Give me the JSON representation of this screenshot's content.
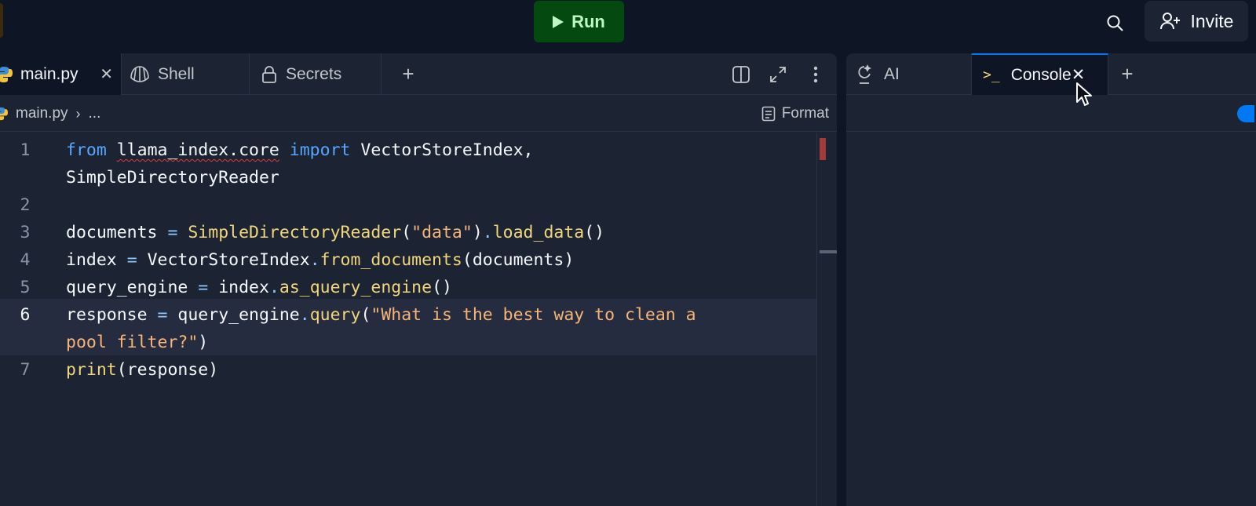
{
  "topbar": {
    "run_label": "Run",
    "invite_label": "Invite"
  },
  "editor": {
    "tabs": [
      {
        "label": "main.py",
        "icon": "python-icon",
        "active": true,
        "closable": true
      },
      {
        "label": "Shell",
        "icon": "shell-icon",
        "active": false
      },
      {
        "label": "Secrets",
        "icon": "lock-icon",
        "active": false
      }
    ],
    "breadcrumb": {
      "file": "main.py",
      "rest": "..."
    },
    "format_label": "Format",
    "code_lines": [
      {
        "number": "1",
        "wrapped": true
      },
      {
        "number": "2"
      },
      {
        "number": "3"
      },
      {
        "number": "4"
      },
      {
        "number": "5"
      },
      {
        "number": "6",
        "current": true,
        "wrapped": true
      },
      {
        "number": "7"
      }
    ],
    "code": {
      "l1_kw1": "from",
      "l1_mod": "llama_index.core",
      "l1_kw2": "import",
      "l1_rest": "VectorStoreIndex,",
      "l1_cont": "SimpleDirectoryReader",
      "l3_var": "documents",
      "l3_eq": "=",
      "l3_fn": "SimpleDirectoryReader",
      "l3_open": "(",
      "l3_str": "\"data\"",
      "l3_close": ")",
      "l3_dot": ".",
      "l3_fn2": "load_data",
      "l3_parens": "()",
      "l4_var": "index",
      "l4_eq": "=",
      "l4_obj": "VectorStoreIndex",
      "l4_dot": ".",
      "l4_fn": "from_documents",
      "l4_args": "(documents)",
      "l5_var": "query_engine",
      "l5_eq": "=",
      "l5_obj": "index",
      "l5_dot": ".",
      "l5_fn": "as_query_engine",
      "l5_parens": "()",
      "l6_var": "response",
      "l6_eq": "=",
      "l6_obj": "query_engine",
      "l6_dot": ".",
      "l6_fn": "query",
      "l6_open": "(",
      "l6_str": "\"What is the best way to clean a",
      "l6_str2": "pool filter?\"",
      "l6_close": ")",
      "l7_fn": "print",
      "l7_args": "(response)"
    }
  },
  "right_pane": {
    "tabs": [
      {
        "label": "AI",
        "icon": "ai-icon",
        "active": false
      },
      {
        "label": "Console",
        "icon": "console-icon",
        "active": true,
        "closable": true
      }
    ]
  },
  "colors": {
    "background": "#0e1525",
    "panel": "#1c2333",
    "run_green": "#044a10",
    "keyword": "#58a6ff",
    "function": "#f1d67a",
    "string": "#f6b477",
    "accent_blue": "#0079f2"
  }
}
